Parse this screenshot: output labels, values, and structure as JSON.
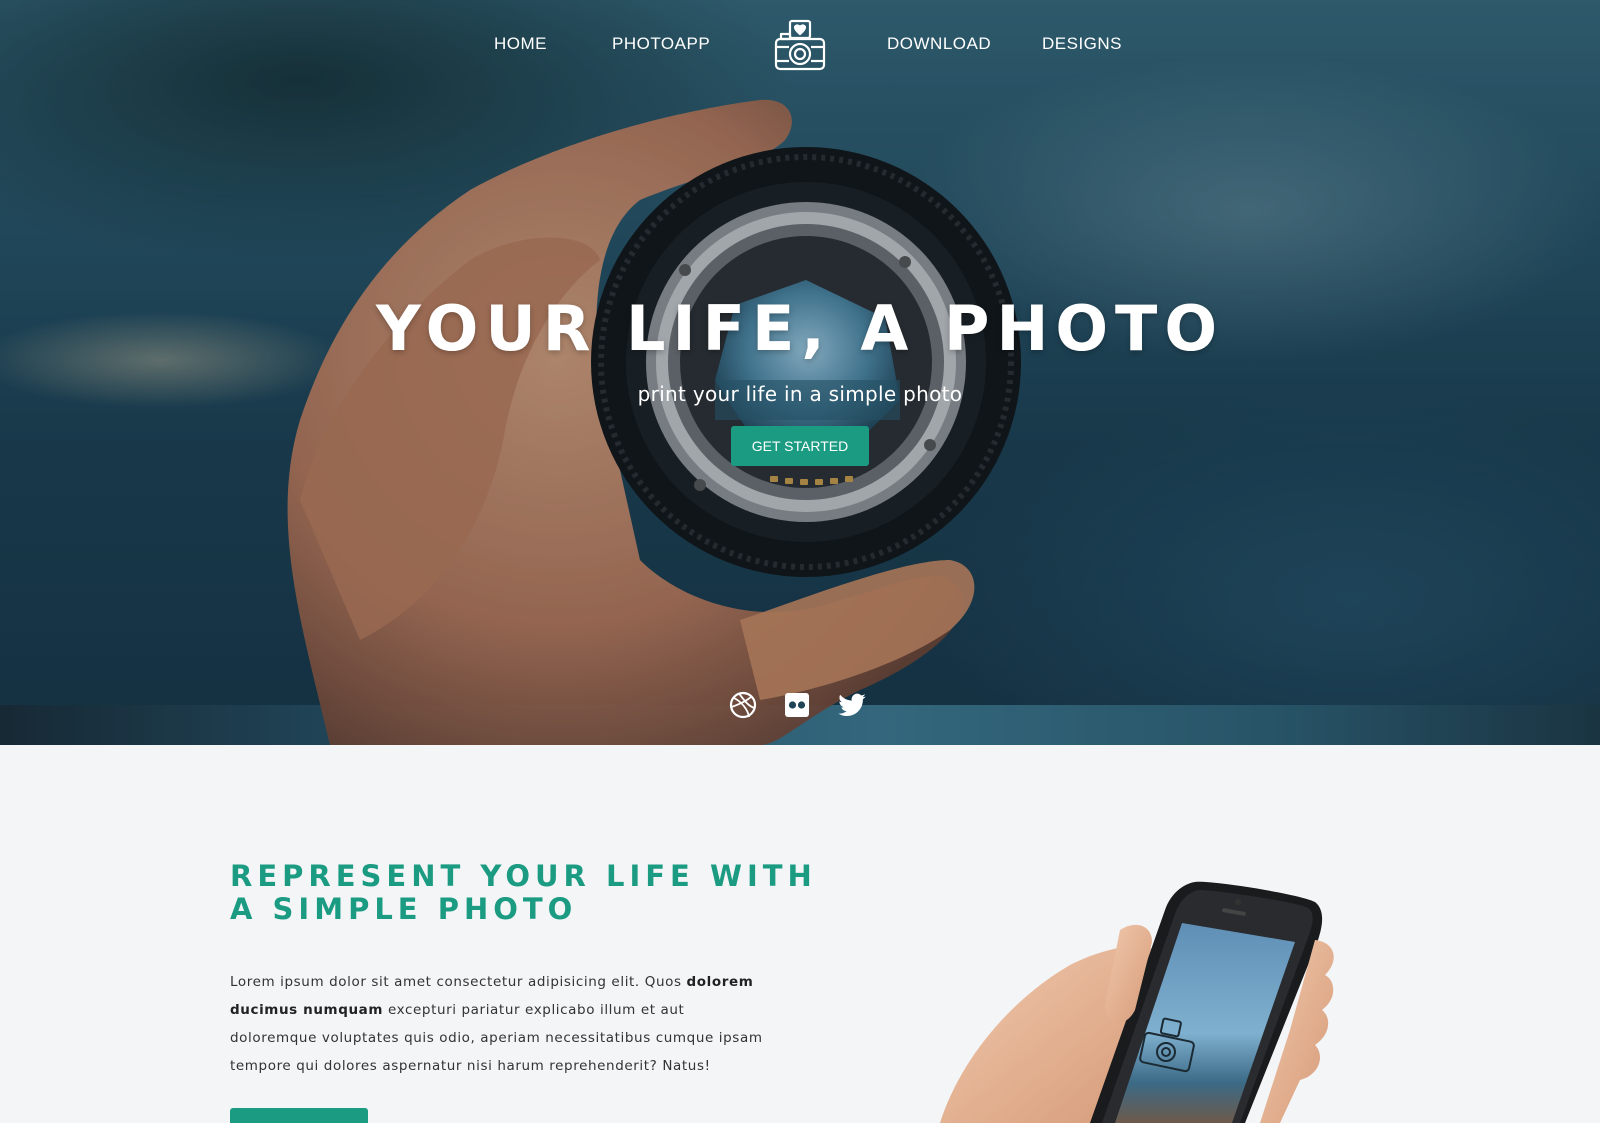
{
  "nav": {
    "items": [
      {
        "label": "HOME"
      },
      {
        "label": "PHOTOAPP"
      },
      {
        "label": "DOWNLOAD"
      },
      {
        "label": "DESIGNS"
      }
    ],
    "logo_icon": "camera-heart-icon"
  },
  "hero": {
    "title": "YOUR LIFE, A PHOTO",
    "subtitle": "print your life in a simple photo",
    "cta_label": "GET STARTED",
    "social_icons": [
      "dribbble-icon",
      "flickr-icon",
      "twitter-icon"
    ]
  },
  "content": {
    "title_line1": "REPRESENT YOUR LIFE WITH",
    "title_line2": "A SIMPLE PHOTO",
    "para_part1": "Lorem ipsum dolor sit amet consectetur adipisicing elit. Quos ",
    "para_bold": "dolorem ducimus numquam",
    "para_part2": " excepturi pariatur explicabo illum et aut doloremque voluptates quis odio, aperiam necessitatibus cumque ipsam tempore qui dolores aspernatur nisi harum reprehenderit? Natus!",
    "phone_image": "phone-in-hand-image"
  },
  "colors": {
    "accent": "#1a9b82",
    "hero_bg": "#244f63",
    "content_bg": "#f4f5f7",
    "heading": "#1a9b82"
  }
}
